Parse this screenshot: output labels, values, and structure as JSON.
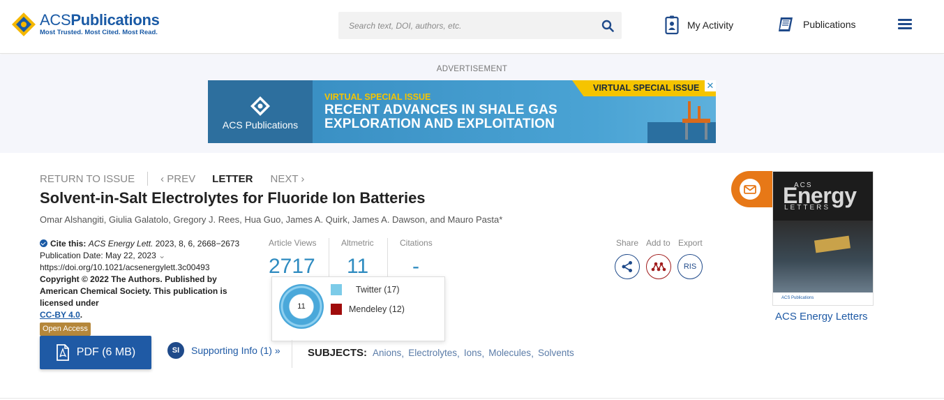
{
  "header": {
    "logo": {
      "title_regular": "ACS",
      "title_bold": "Publications",
      "tagline": "Most Trusted. Most Cited. Most Read."
    },
    "search": {
      "placeholder": "Search text, DOI, authors, etc."
    },
    "nav": {
      "my_activity": "My Activity",
      "publications": "Publications"
    },
    "icons": {
      "search": "search-icon",
      "activity": "user-badge-icon",
      "publications": "book-icon",
      "menu": "hamburger-menu-icon"
    },
    "brand_color": "#1a5aa5"
  },
  "ad": {
    "label": "ADVERTISEMENT",
    "publisher": "ACS Publications",
    "kicker": "VIRTUAL SPECIAL ISSUE",
    "title_line1": "RECENT ADVANCES IN SHALE GAS",
    "title_line2": "EXPLORATION AND EXPLOITATION",
    "ribbon": "VIRTUAL SPECIAL ISSUE",
    "close": "✕"
  },
  "breadcrumb": {
    "return": "RETURN TO ISSUE",
    "prev": "‹ PREV",
    "current": "LETTER",
    "next": "NEXT ›"
  },
  "article": {
    "title": "Solvent-in-Salt Electrolytes for Fluoride Ion Batteries",
    "authors": "Omar Alshangiti, Giulia Galatolo, Gregory J. Rees, Hua Guo, James A. Quirk, James A. Dawson, and Mauro Pasta*",
    "cite_label": "Cite this:",
    "cite_journal": "ACS Energy Lett.",
    "cite_ref": " 2023, 8, 6, 2668−2673",
    "pub_date": "Publication Date: May 22, 2023",
    "pub_date_chevron": "⌄",
    "doi": "https://doi.org/10.1021/acsenergylett.3c00493",
    "copyright": "Copyright © 2022 The Authors. Published by American Chemical Society. This publication is licensed under",
    "license": "CC-BY 4.0",
    "license_suffix": ".",
    "open_access": "Open Access"
  },
  "metrics": {
    "views": {
      "label": "Article Views",
      "value": "2717"
    },
    "altmetric": {
      "label": "Altmetric",
      "value": "11"
    },
    "citations": {
      "label": "Citations",
      "value": "-"
    },
    "popover": {
      "score": "11",
      "rows": [
        {
          "label": "Twitter (17)",
          "color": "#7ccbe8"
        },
        {
          "label": "Mendeley (12)",
          "color": "#a00c0c"
        }
      ]
    }
  },
  "tools": {
    "share": "Share",
    "add_to": "Add to",
    "export": "Export",
    "ris": "RIS"
  },
  "actions": {
    "pdf": "PDF (6 MB)",
    "si_badge": "SI",
    "supporting_info": "Supporting Info (1) »"
  },
  "subjects": {
    "heading": "SUBJECTS:",
    "items": [
      "Anions",
      "Electrolytes",
      "Ions",
      "Molecules",
      "Solvents"
    ]
  },
  "cover": {
    "acs": "ACS",
    "energy": "Energy",
    "letters": "LETTERS",
    "footer": "ACS Publications",
    "title": "ACS Energy Letters"
  }
}
